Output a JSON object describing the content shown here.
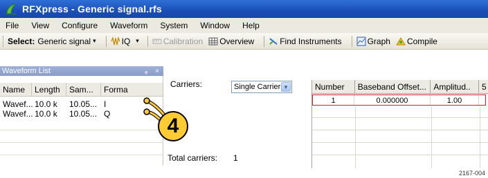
{
  "window": {
    "title": "RFXpress - Generic signal.rfs"
  },
  "menu": [
    "File",
    "View",
    "Configure",
    "Waveform",
    "System",
    "Window",
    "Help"
  ],
  "toolbar": {
    "select_label": "Select:",
    "select_value": "Generic signal",
    "iq_label": "IQ",
    "calibration_label": "Calibration",
    "overview_label": "Overview",
    "find_label": "Find Instruments",
    "graph_label": "Graph",
    "compile_label": "Compile"
  },
  "waveform_list": {
    "title": "Waveform List",
    "columns": [
      "Name",
      "Length",
      "Sam...",
      "Forma"
    ],
    "rows": [
      [
        "Wavef...",
        "10.0 k",
        "10.05...",
        "I"
      ],
      [
        "Wavef...",
        "10.0 k",
        "10.05...",
        "Q"
      ]
    ]
  },
  "carriers": {
    "label": "Carriers:",
    "select_value": "Single Carrier",
    "total_label": "Total carriers:",
    "total_value": "1"
  },
  "carrier_table": {
    "columns": [
      "Number",
      "Baseband Offset...",
      "Amplitud..",
      "5"
    ],
    "rows": [
      [
        "1",
        "0.000000",
        "1.00"
      ]
    ]
  },
  "callout": {
    "number": "4"
  },
  "figure_id": "2167-004",
  "colors": {
    "title_bar": "#1a4fb8",
    "callout": "#ffcc33",
    "selected_row_border": "#cc2222"
  }
}
